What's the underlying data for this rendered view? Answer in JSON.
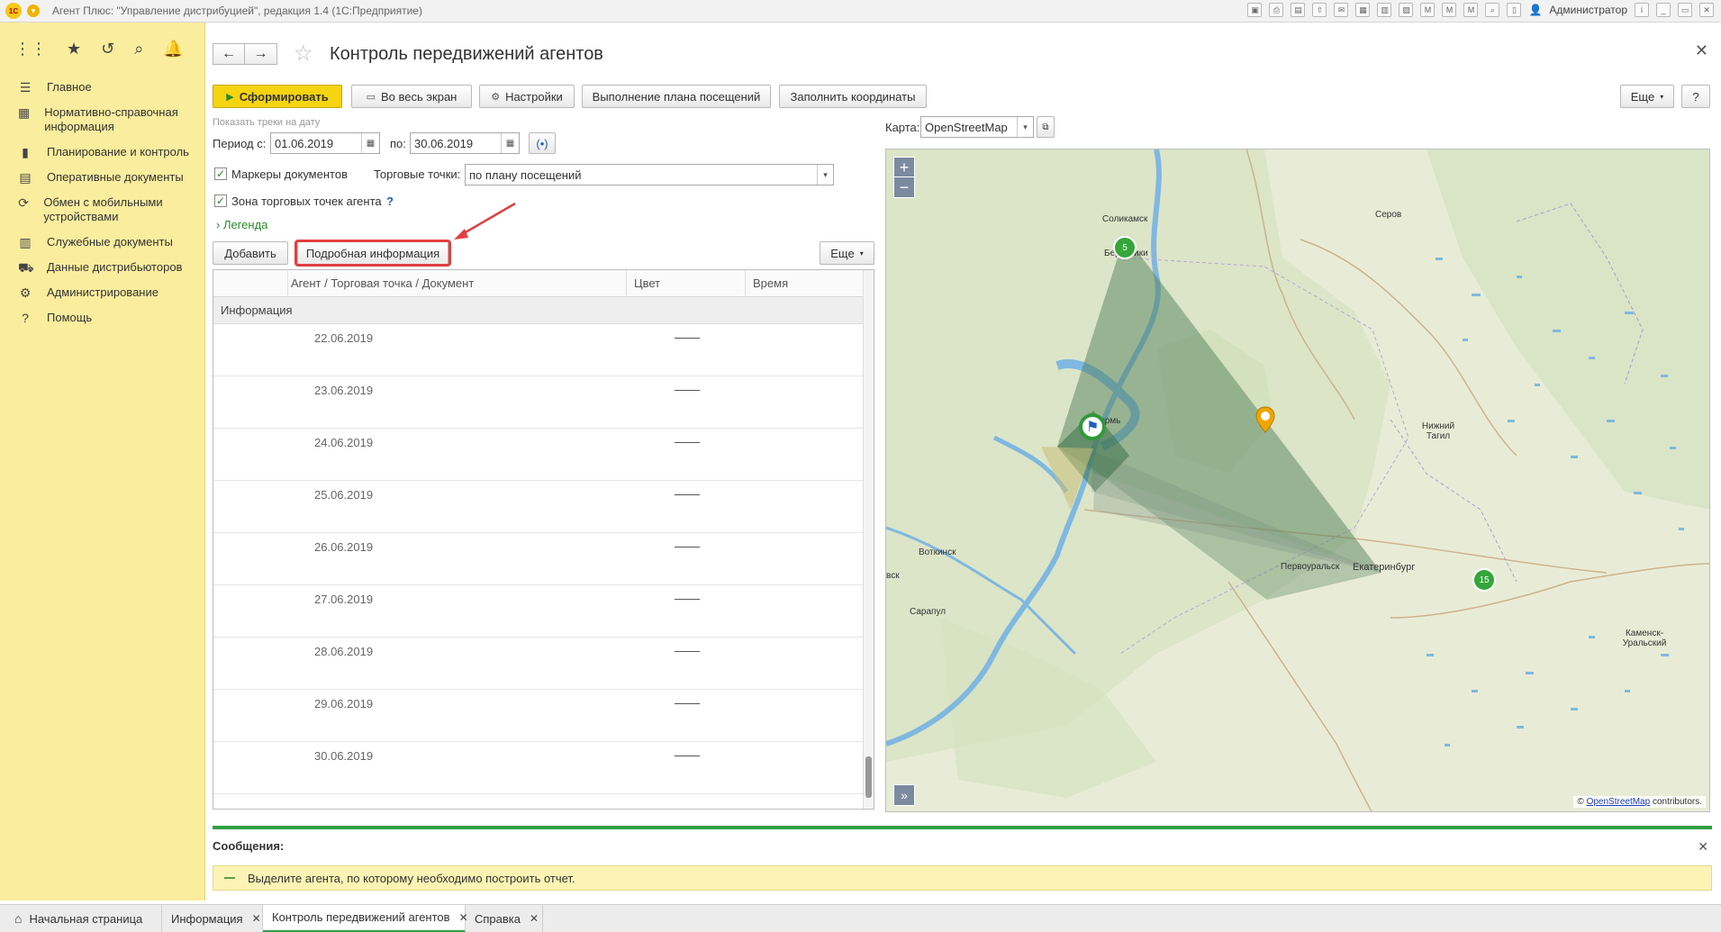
{
  "app": {
    "title": "Агент Плюс: \"Управление дистрибуцией\", редакция 1.4  (1С:Предприятие)",
    "user": "Администратор"
  },
  "sidebar": {
    "items": [
      {
        "label": "Главное",
        "icon": "list-icon"
      },
      {
        "label": "Нормативно-справочная информация",
        "icon": "catalog-icon"
      },
      {
        "label": "Планирование и контроль",
        "icon": "chart-icon"
      },
      {
        "label": "Оперативные документы",
        "icon": "document-icon"
      },
      {
        "label": "Обмен с мобильными устройствами",
        "icon": "sync-icon"
      },
      {
        "label": "Служебные документы",
        "icon": "service-icon"
      },
      {
        "label": "Данные дистрибьюторов",
        "icon": "truck-icon"
      },
      {
        "label": "Администрирование",
        "icon": "gear-icon"
      },
      {
        "label": "Помощь",
        "icon": "help-icon"
      }
    ]
  },
  "form": {
    "title": "Контроль передвижений агентов"
  },
  "toolbar": {
    "generate": "Сформировать",
    "fullscreen": "Во весь экран",
    "settings": "Настройки",
    "plan": "Выполнение плана посещений",
    "fill_coords": "Заполнить координаты",
    "more": "Еще"
  },
  "filters": {
    "hint": "Показать треки на дату",
    "period_label": "Период с:",
    "date_from": "01.06.2019",
    "to_label": "по:",
    "date_to": "30.06.2019",
    "doc_markers": "Маркеры документов",
    "trade_points_label": "Торговые точки:",
    "trade_points_value": "по плану посещений",
    "agent_zone": "Зона торговых точек агента",
    "help": "?",
    "legend": "Легенда"
  },
  "table_toolbar": {
    "add": "Добавить",
    "details": "Подробная информация",
    "more": "Еще"
  },
  "table": {
    "columns": [
      "Агент / Торговая точка / Документ",
      "Цвет",
      "Время"
    ],
    "group": "Информация",
    "rows": [
      "22.06.2019",
      "23.06.2019",
      "24.06.2019",
      "25.06.2019",
      "26.06.2019",
      "27.06.2019",
      "28.06.2019",
      "29.06.2019",
      "30.06.2019"
    ]
  },
  "map": {
    "label": "Карта:",
    "provider": "OpenStreetMap",
    "zoom_in": "+",
    "zoom_out": "−",
    "expand": "»",
    "attribution_prefix": "© ",
    "attribution_link": "OpenStreetMap",
    "attribution_suffix": " contributors.",
    "clusters": [
      "5",
      "15"
    ],
    "places": [
      "Соликамск",
      "Березники",
      "Серов",
      "Нижний Тагил",
      "Воткинск",
      "Первоуральск",
      "Екатеринбург",
      "Сарапул",
      "Каменск-Уральский",
      "вск",
      "Пермь"
    ]
  },
  "messages": {
    "title": "Сообщения:",
    "text": "Выделите агента, по которому необходимо построить отчет."
  },
  "tabs": [
    {
      "label": "Начальная страница"
    },
    {
      "label": "Информация"
    },
    {
      "label": "Контроль передвижений агентов"
    },
    {
      "label": "Справка"
    }
  ]
}
